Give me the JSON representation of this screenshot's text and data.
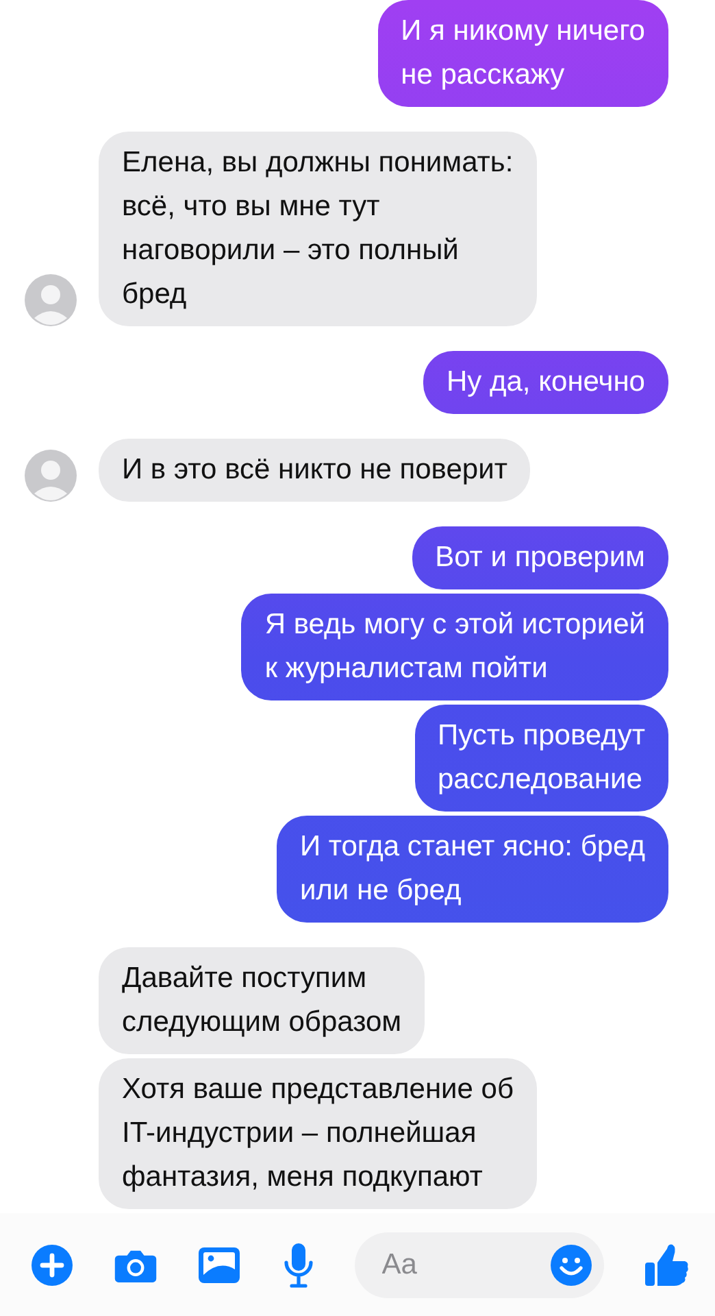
{
  "messages": [
    {
      "kind": "outgoing",
      "text": "И я никому ничего\nне расскажу"
    },
    {
      "kind": "incoming",
      "text": "Елена, вы должны понимать:\nвсё, что вы мне тут\nнаговорили – это полный\nбред",
      "show_avatar": true
    },
    {
      "kind": "outgoing",
      "text": "Ну да, конечно"
    },
    {
      "kind": "incoming",
      "text": "И в это всё никто не поверит",
      "show_avatar": true
    },
    {
      "kind": "outgoing",
      "text": "Вот и проверим"
    },
    {
      "kind": "outgoing",
      "text": "Я ведь могу с этой историей\nк журналистам пойти"
    },
    {
      "kind": "outgoing",
      "text": "Пусть проведут\nрасследование"
    },
    {
      "kind": "outgoing",
      "text": "И тогда станет ясно: бред\nили не бред"
    },
    {
      "kind": "incoming",
      "text": "Давайте поступим\nследующим образом",
      "show_avatar": false
    },
    {
      "kind": "incoming",
      "text": "Хотя ваше представление об\nIT-индустрии – полнейшая\nфантазия, меня подкупают",
      "show_avatar": false
    }
  ],
  "composer": {
    "placeholder": "Aa"
  }
}
